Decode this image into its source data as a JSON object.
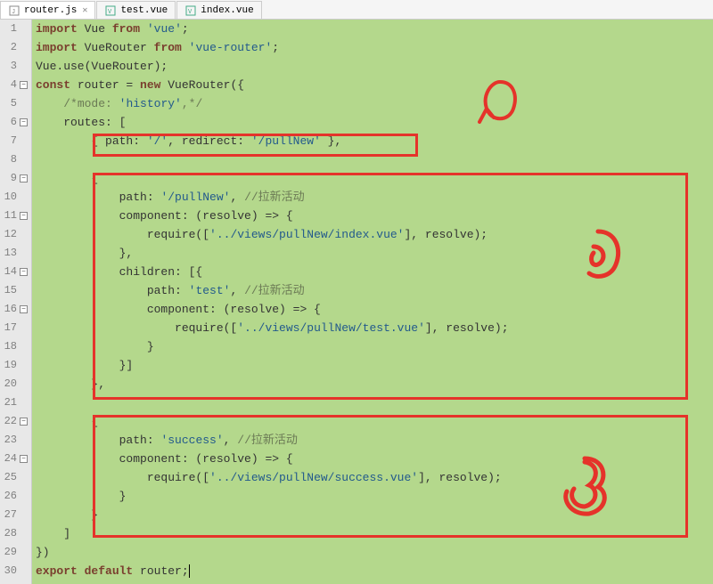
{
  "tabs": [
    {
      "label": "router.js",
      "active": true,
      "closeable": true
    },
    {
      "label": "test.vue",
      "active": false,
      "closeable": false
    },
    {
      "label": "index.vue",
      "active": false,
      "closeable": false
    }
  ],
  "lines": [
    {
      "n": "1",
      "fold": "",
      "code": "import Vue from 'vue';"
    },
    {
      "n": "2",
      "fold": "",
      "code": "import VueRouter from 'vue-router';"
    },
    {
      "n": "3",
      "fold": "",
      "code": "Vue.use(VueRouter);"
    },
    {
      "n": "4",
      "fold": "-",
      "code": "const router = new VueRouter({"
    },
    {
      "n": "5",
      "fold": "",
      "code": "    /*mode: 'history',*/"
    },
    {
      "n": "6",
      "fold": "-",
      "code": "    routes: ["
    },
    {
      "n": "7",
      "fold": "",
      "code": "        { path: '/', redirect: '/pullNew' },"
    },
    {
      "n": "8",
      "fold": "",
      "code": ""
    },
    {
      "n": "9",
      "fold": "-",
      "code": "        {"
    },
    {
      "n": "10",
      "fold": "",
      "code": "            path: '/pullNew', //拉新活动"
    },
    {
      "n": "11",
      "fold": "-",
      "code": "            component: (resolve) => {"
    },
    {
      "n": "12",
      "fold": "",
      "code": "                require(['../views/pullNew/index.vue'], resolve);"
    },
    {
      "n": "13",
      "fold": "",
      "code": "            },"
    },
    {
      "n": "14",
      "fold": "-",
      "code": "            children: [{"
    },
    {
      "n": "15",
      "fold": "",
      "code": "                path: 'test', //拉新活动"
    },
    {
      "n": "16",
      "fold": "-",
      "code": "                component: (resolve) => {"
    },
    {
      "n": "17",
      "fold": "",
      "code": "                    require(['../views/pullNew/test.vue'], resolve);"
    },
    {
      "n": "18",
      "fold": "",
      "code": "                }"
    },
    {
      "n": "19",
      "fold": "",
      "code": "            }]"
    },
    {
      "n": "20",
      "fold": "",
      "code": "        },"
    },
    {
      "n": "21",
      "fold": "",
      "code": ""
    },
    {
      "n": "22",
      "fold": "-",
      "code": "        {"
    },
    {
      "n": "23",
      "fold": "",
      "code": "            path: 'success', //拉新活动"
    },
    {
      "n": "24",
      "fold": "-",
      "code": "            component: (resolve) => {"
    },
    {
      "n": "25",
      "fold": "",
      "code": "                require(['../views/pullNew/success.vue'], resolve);"
    },
    {
      "n": "26",
      "fold": "",
      "code": "            }"
    },
    {
      "n": "27",
      "fold": "",
      "code": "        }"
    },
    {
      "n": "28",
      "fold": "",
      "code": "    ]"
    },
    {
      "n": "29",
      "fold": "",
      "code": "})"
    },
    {
      "n": "30",
      "fold": "",
      "code": "export default router;"
    }
  ]
}
